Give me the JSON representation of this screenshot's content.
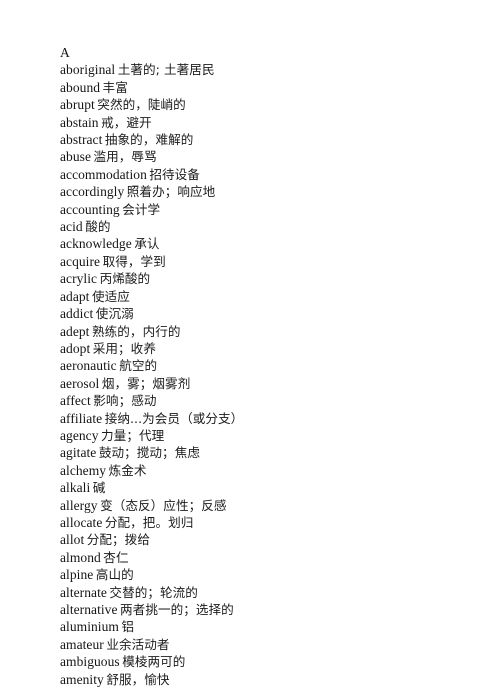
{
  "document": {
    "section_letter": "A",
    "entries": [
      {
        "headword": "aboriginal",
        "gloss": "土著的; 土著居民"
      },
      {
        "headword": "abound",
        "gloss": "丰富"
      },
      {
        "headword": "abrupt",
        "gloss": "突然的，陡峭的"
      },
      {
        "headword": "abstain",
        "gloss": "戒，避开"
      },
      {
        "headword": "abstract",
        "gloss": "抽象的，难解的"
      },
      {
        "headword": "abuse",
        "gloss": "滥用，辱骂"
      },
      {
        "headword": "accommodation",
        "gloss": "招待设备"
      },
      {
        "headword": "accordingly",
        "gloss": "照着办；响应地"
      },
      {
        "headword": "accounting",
        "gloss": "会计学"
      },
      {
        "headword": "acid",
        "gloss": "酸的"
      },
      {
        "headword": "acknowledge",
        "gloss": "承认"
      },
      {
        "headword": "acquire",
        "gloss": "取得，学到"
      },
      {
        "headword": "acrylic",
        "gloss": "丙烯酸的"
      },
      {
        "headword": "adapt",
        "gloss": "使适应"
      },
      {
        "headword": "addict",
        "gloss": "使沉溺"
      },
      {
        "headword": "adept",
        "gloss": "熟练的，内行的"
      },
      {
        "headword": "adopt",
        "gloss": "采用；收养"
      },
      {
        "headword": "aeronautic",
        "gloss": "航空的"
      },
      {
        "headword": "aerosol",
        "gloss": "烟，雾；烟雾剂"
      },
      {
        "headword": "affect",
        "gloss": "影响；感动"
      },
      {
        "headword": "affiliate",
        "gloss": "接纳...为会员（或分支）"
      },
      {
        "headword": "agency",
        "gloss": "力量；代理"
      },
      {
        "headword": "agitate",
        "gloss": "鼓动；搅动；焦虑"
      },
      {
        "headword": "alchemy",
        "gloss": "炼金术"
      },
      {
        "headword": "alkali",
        "gloss": "碱"
      },
      {
        "headword": "allergy",
        "gloss": "变（态反）应性；反感"
      },
      {
        "headword": "allocate",
        "gloss": "分配，把。划归"
      },
      {
        "headword": "allot",
        "gloss": "分配；拨给"
      },
      {
        "headword": "almond",
        "gloss": "杏仁"
      },
      {
        "headword": "alpine",
        "gloss": "高山的"
      },
      {
        "headword": "alternate",
        "gloss": "交替的；轮流的"
      },
      {
        "headword": "alternative",
        "gloss": "两者挑一的；选择的"
      },
      {
        "headword": "aluminium",
        "gloss": "铝"
      },
      {
        "headword": "amateur",
        "gloss": "业余活动者"
      },
      {
        "headword": "ambiguous",
        "gloss": "模棱两可的"
      },
      {
        "headword": "amenity",
        "gloss": "舒服，愉快"
      }
    ]
  }
}
